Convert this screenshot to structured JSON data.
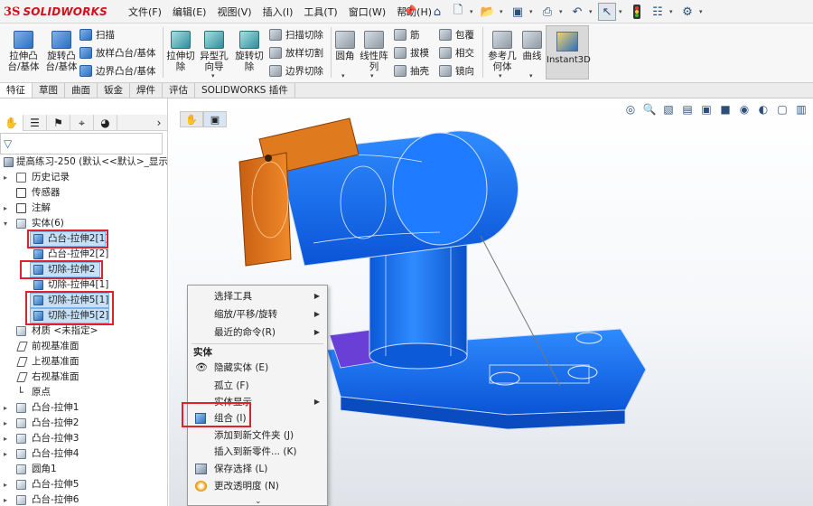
{
  "app": {
    "logo_mark": "3S",
    "logo_text": "SOLIDWORKS"
  },
  "menu": [
    "文件(F)",
    "编辑(E)",
    "视图(V)",
    "插入(I)",
    "工具(T)",
    "窗口(W)",
    "帮助(H)"
  ],
  "quick_icons": [
    "home-icon",
    "new-doc-icon",
    "open-icon",
    "save-icon",
    "print-icon",
    "undo-icon",
    "select-arrow-icon",
    "traffic-light-icon",
    "options-icon",
    "gear-icon"
  ],
  "ribbon": {
    "extrude_boss": "拉伸凸\n台/基体",
    "revolve_boss": "旋转凸\n台/基体",
    "sweep": "扫描",
    "loft": "放样凸台/基体",
    "boundary": "边界凸台/基体",
    "extrude_cut": "拉伸切\n除",
    "hole_wizard": "异型孔\n向导",
    "revolve_cut": "旋转切\n除",
    "swept_cut": "扫描切除",
    "lofted_cut": "放样切割",
    "boundary_cut": "边界切除",
    "fillet": "圆角",
    "linear_pattern": "线性阵\n列",
    "rib": "筋",
    "draft": "拔模",
    "shell": "抽壳",
    "wrap": "包覆",
    "intersect": "相交",
    "mirror": "镜向",
    "ref_geometry": "参考几\n何体",
    "curves": "曲线",
    "instant3d": "Instant3D"
  },
  "tabs": [
    "特征",
    "草图",
    "曲面",
    "钣金",
    "焊件",
    "评估",
    "SOLIDWORKS 插件"
  ],
  "tree": {
    "root": "提高练习-250  (默认<<默认>_显示状态",
    "history": "历史记录",
    "sensors": "传感器",
    "annotations": "注解",
    "solid_bodies": "实体(6)",
    "bodies": [
      "凸台-拉伸2[1]",
      "凸台-拉伸2[2]",
      "切除-拉伸2",
      "切除-拉伸4[1]",
      "切除-拉伸5[1]",
      "切除-拉伸5[2]"
    ],
    "material": "材质 <未指定>",
    "front_plane": "前视基准面",
    "top_plane": "上视基准面",
    "right_plane": "右视基准面",
    "origin": "原点",
    "features": [
      "凸台-拉伸1",
      "凸台-拉伸2",
      "凸台-拉伸3",
      "凸台-拉伸4",
      "圆角1",
      "凸台-拉伸5",
      "凸台-拉伸6"
    ]
  },
  "context_menu": {
    "select_tools": "选择工具",
    "zoom_pan_rotate": "缩放/平移/旋转",
    "recent_commands": "最近的命令(R)",
    "section_title": "实体",
    "hide_body": "隐藏实体 (E)",
    "isolate": "孤立 (F)",
    "body_display": "实体显示",
    "combine": "组合 (I)",
    "add_to_folder": "添加到新文件夹 (J)",
    "insert_into_part": "插入到新零件... (K)",
    "save_selection": "保存选择 (L)",
    "change_transparency": "更改透明度 (N)"
  },
  "colors": {
    "accent": "#2d6fbf",
    "highlight": "#e0202a",
    "model_blue": "#0a6cff",
    "model_orange": "#e0721a",
    "model_purple": "#6a3fd6"
  }
}
